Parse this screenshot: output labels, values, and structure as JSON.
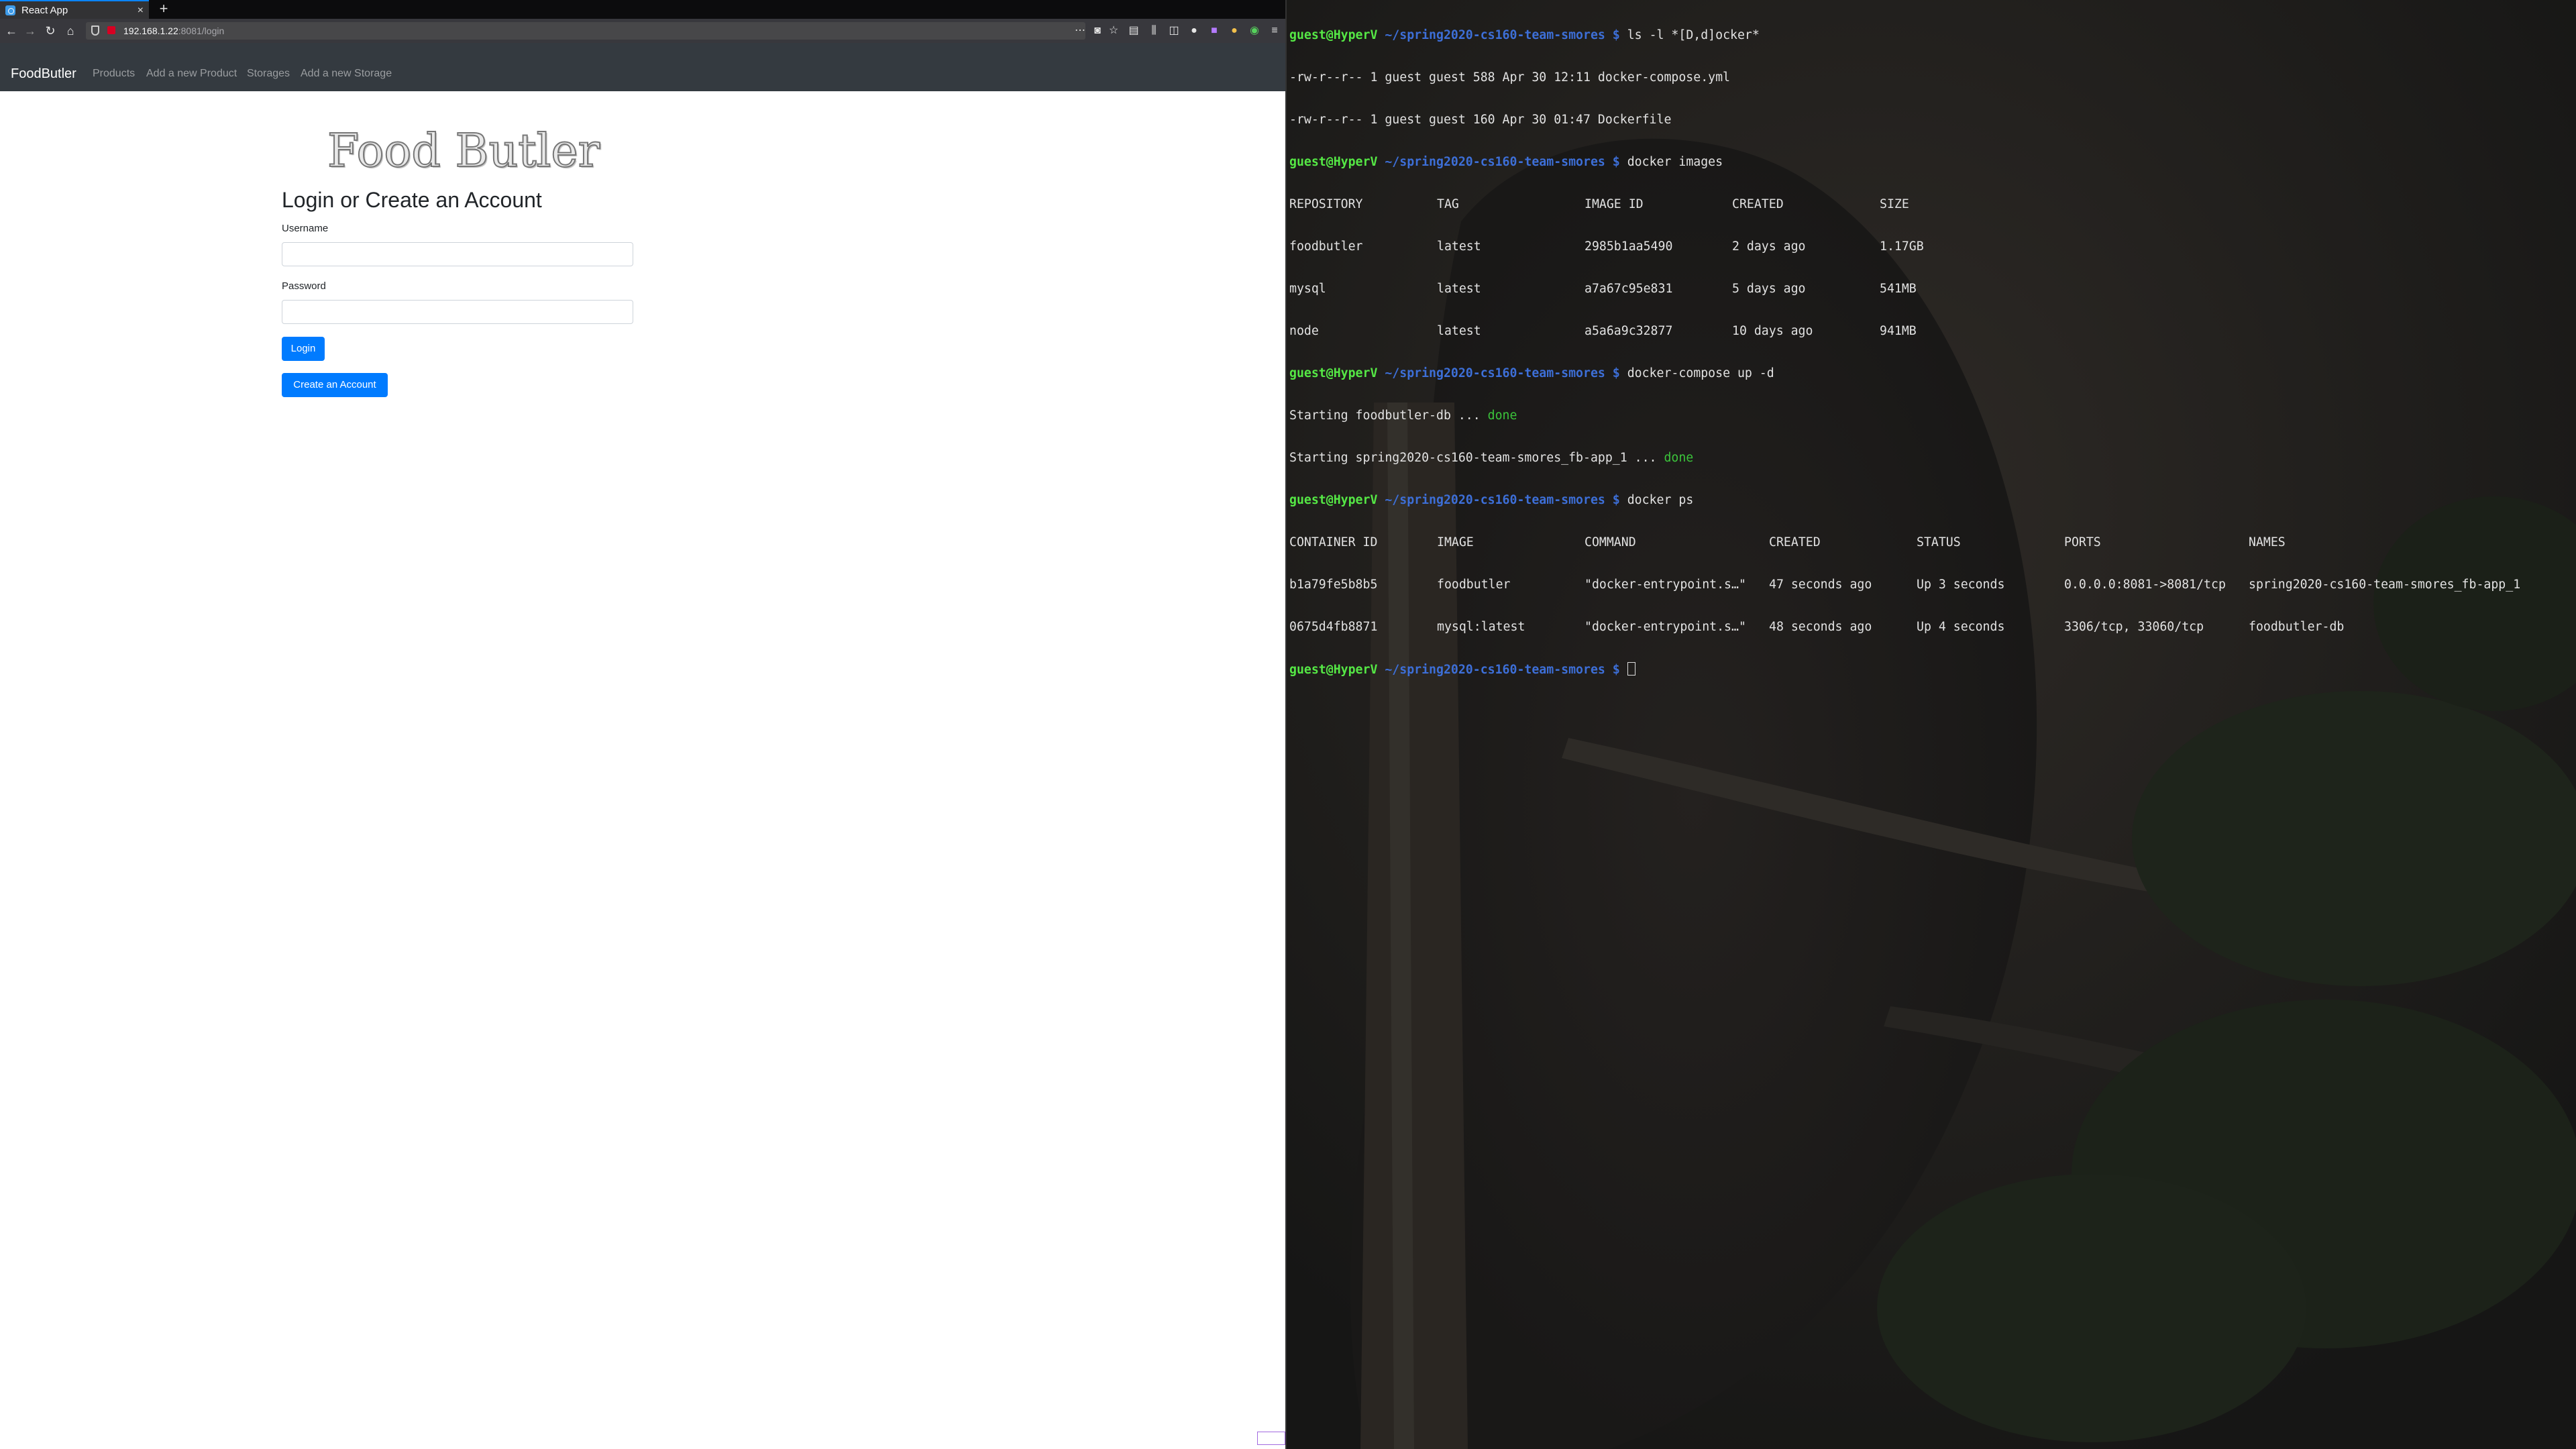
{
  "browser": {
    "tab_title": "React App",
    "tab_close": "×",
    "new_tab": "+",
    "url_host": "192.168.1.22",
    "url_rest": ":8081/login"
  },
  "app": {
    "brand": "FoodButler",
    "nav": [
      "Products",
      "Add a new Product",
      "Storages",
      "Add a new Storage"
    ],
    "logo": "Food Butler",
    "heading": "Login or Create an Account",
    "username_label": "Username",
    "password_label": "Password",
    "login_button": "Login",
    "create_button": "Create an Account"
  },
  "terminal": {
    "prompt_user": "guest@HyperV",
    "prompt_path": "~/spring2020-cs160-team-smores $",
    "cmd1": " ls -l *[D,d]ocker*",
    "ls_lines": [
      "-rw-r--r-- 1 guest guest 588 Apr 30 12:11 docker-compose.yml",
      "-rw-r--r-- 1 guest guest 160 Apr 30 01:47 Dockerfile"
    ],
    "cmd2": " docker images",
    "images_header": [
      "REPOSITORY",
      "TAG",
      "IMAGE ID",
      "CREATED",
      "SIZE"
    ],
    "images_rows": [
      [
        "foodbutler",
        "latest",
        "2985b1aa5490",
        "2 days ago",
        "1.17GB"
      ],
      [
        "mysql",
        "latest",
        "a7a67c95e831",
        "5 days ago",
        "541MB"
      ],
      [
        "node",
        "latest",
        "a5a6a9c32877",
        "10 days ago",
        "941MB"
      ]
    ],
    "cmd3": " docker-compose up -d",
    "compose_lines": [
      {
        "text": "Starting foodbutler-db ... ",
        "status": "done"
      },
      {
        "text": "Starting spring2020-cs160-team-smores_fb-app_1 ... ",
        "status": "done"
      }
    ],
    "cmd4": " docker ps",
    "ps_header": [
      "CONTAINER ID",
      "IMAGE",
      "COMMAND",
      "CREATED",
      "STATUS",
      "PORTS",
      "NAMES"
    ],
    "ps_rows": [
      [
        "b1a79fe5b8b5",
        "foodbutler",
        "\"docker-entrypoint.s…\"",
        "47 seconds ago",
        "Up 3 seconds",
        "0.0.0.0:8081->8081/tcp",
        "spring2020-cs160-team-smores_fb-app_1"
      ],
      [
        "0675d4fb8871",
        "mysql:latest",
        "\"docker-entrypoint.s…\"",
        "48 seconds ago",
        "Up 4 seconds",
        "3306/tcp, 33060/tcp",
        "foodbutler-db"
      ]
    ]
  }
}
